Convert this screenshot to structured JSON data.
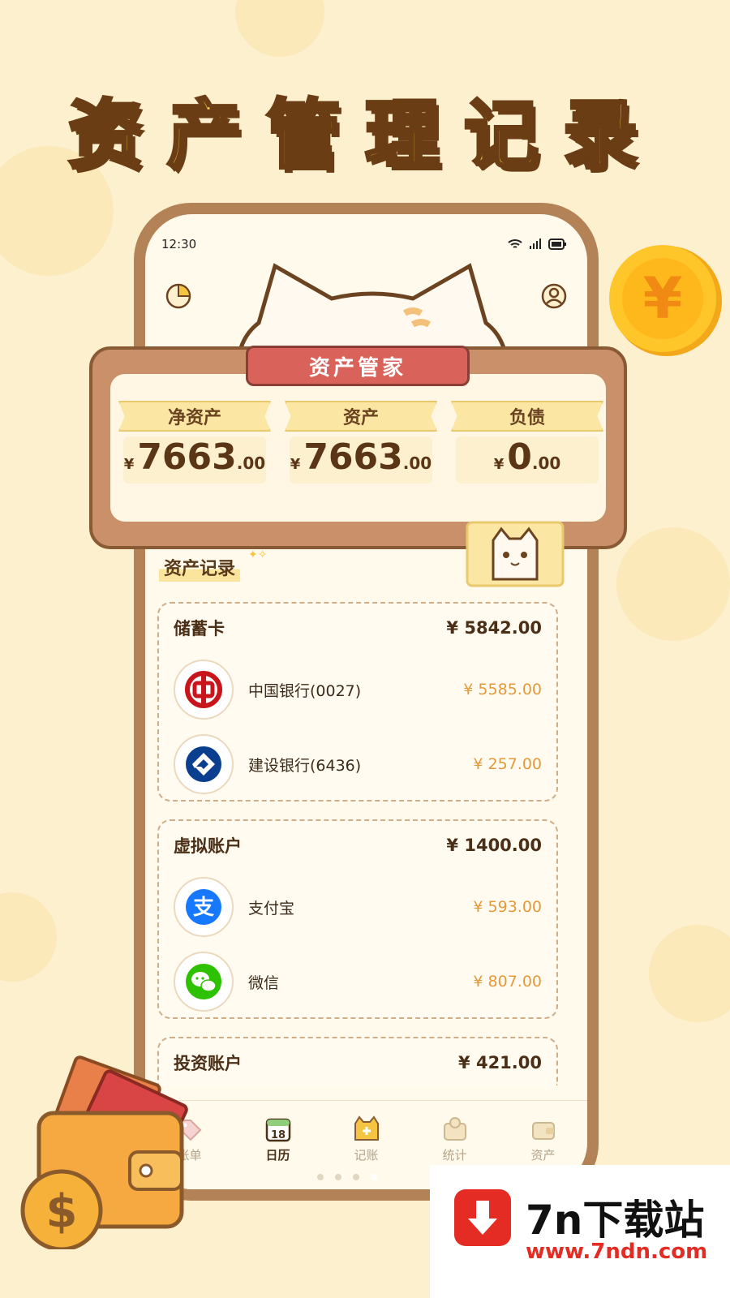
{
  "headline": "资产管理记录",
  "status_bar": {
    "time": "12:30"
  },
  "header": {
    "banner": "资产管家"
  },
  "summary": [
    {
      "label": "净资产",
      "currency": "¥",
      "integer": "7663",
      "decimal": ".00"
    },
    {
      "label": "资产",
      "currency": "¥",
      "integer": "7663",
      "decimal": ".00"
    },
    {
      "label": "负债",
      "currency": "¥",
      "integer": "0",
      "decimal": ".00"
    }
  ],
  "section_title": "资产记录",
  "groups": [
    {
      "name": "储蓄卡",
      "total": "¥ 5842.00",
      "items": [
        {
          "name": "中国银行(0027)",
          "amount": "¥ 5585.00",
          "icon": "bank-of-china-icon"
        },
        {
          "name": "建设银行(6436)",
          "amount": "¥ 257.00",
          "icon": "ccb-icon"
        }
      ]
    },
    {
      "name": "虚拟账户",
      "total": "¥ 1400.00",
      "items": [
        {
          "name": "支付宝",
          "amount": "¥ 593.00",
          "icon": "alipay-icon"
        },
        {
          "name": "微信",
          "amount": "¥ 807.00",
          "icon": "wechat-icon"
        }
      ]
    },
    {
      "name": "投资账户",
      "total": "¥ 421.00",
      "items": []
    }
  ],
  "tabs": [
    {
      "label": "账单",
      "icon": "bill-tag-icon",
      "active": false
    },
    {
      "label": "日历",
      "icon": "calendar-icon",
      "active": true,
      "day": "18"
    },
    {
      "label": "记账",
      "icon": "cat-plus-icon",
      "active": false
    },
    {
      "label": "统计",
      "icon": "stats-icon",
      "active": false
    },
    {
      "label": "资产",
      "icon": "wallet-icon",
      "active": false
    }
  ],
  "watermark": {
    "title": "7n下载站",
    "url": "www.7ndn.com"
  },
  "decor": {
    "coin_symbol": "¥",
    "wallet_symbol": "$"
  },
  "colors": {
    "background": "#fcf0cf",
    "accent": "#e39a3b",
    "ribbon": "#d9635a",
    "headline": "#ffd24a"
  }
}
